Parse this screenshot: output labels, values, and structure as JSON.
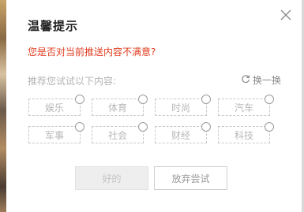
{
  "dialog": {
    "title": "温馨提示",
    "question": "您是否对当前推送内容不满意?",
    "prompt": "推荐您试试以下内容:",
    "refresh_label": "换一换",
    "tags": [
      "娱乐",
      "体育",
      "时尚",
      "汽车",
      "军事",
      "社会",
      "财经",
      "科技"
    ],
    "ok_label": "好的",
    "skip_label": "放弃尝试"
  },
  "colors": {
    "question": "#e03c1f",
    "muted": "#b3b3b3"
  },
  "icons": {
    "close": "close-icon",
    "refresh": "refresh-icon"
  }
}
